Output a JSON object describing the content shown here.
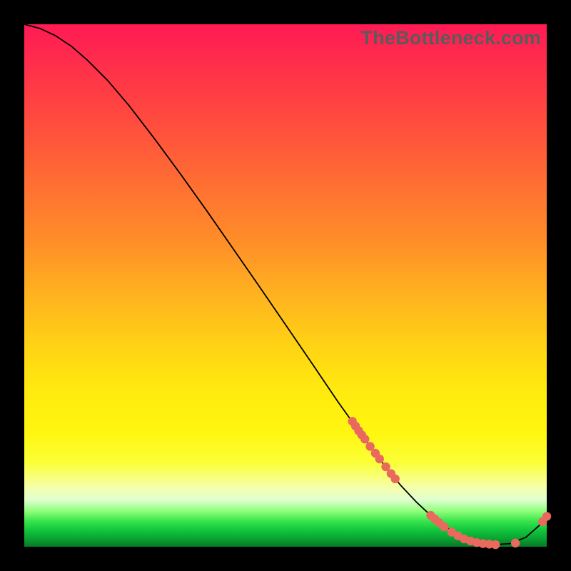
{
  "watermark": "TheBottleneck.com",
  "chart_data": {
    "type": "line",
    "title": "",
    "xlabel": "",
    "ylabel": "",
    "xlim": [
      0,
      10
    ],
    "ylim": [
      0,
      10
    ],
    "x": [
      0.0,
      0.3,
      0.6,
      0.9,
      1.2,
      1.6,
      2.0,
      2.5,
      3.0,
      3.5,
      4.0,
      4.5,
      5.0,
      5.5,
      6.0,
      6.3,
      6.6,
      6.9,
      7.2,
      7.5,
      7.8,
      8.1,
      8.4,
      8.7,
      9.0,
      9.3,
      9.6,
      9.85,
      10.0
    ],
    "y": [
      10.0,
      9.92,
      9.78,
      9.58,
      9.32,
      8.92,
      8.45,
      7.8,
      7.12,
      6.42,
      5.7,
      4.98,
      4.25,
      3.52,
      2.78,
      2.36,
      1.94,
      1.55,
      1.18,
      0.86,
      0.58,
      0.36,
      0.2,
      0.09,
      0.04,
      0.06,
      0.18,
      0.4,
      0.58
    ],
    "dots_x": [
      6.28,
      6.34,
      6.4,
      6.46,
      6.52,
      6.62,
      6.72,
      6.8,
      6.92,
      7.02,
      7.1,
      7.78,
      7.86,
      7.94,
      8.04,
      8.18,
      8.3,
      8.42,
      8.54,
      8.66,
      8.78,
      8.9,
      9.02,
      9.4,
      9.92,
      10.0
    ],
    "dots_y": [
      2.4,
      2.31,
      2.22,
      2.14,
      2.06,
      1.92,
      1.79,
      1.68,
      1.53,
      1.4,
      1.3,
      0.6,
      0.53,
      0.46,
      0.38,
      0.28,
      0.21,
      0.15,
      0.11,
      0.08,
      0.06,
      0.05,
      0.04,
      0.07,
      0.48,
      0.58
    ],
    "dot_color": "#e9695e",
    "line_color": "#000000"
  }
}
